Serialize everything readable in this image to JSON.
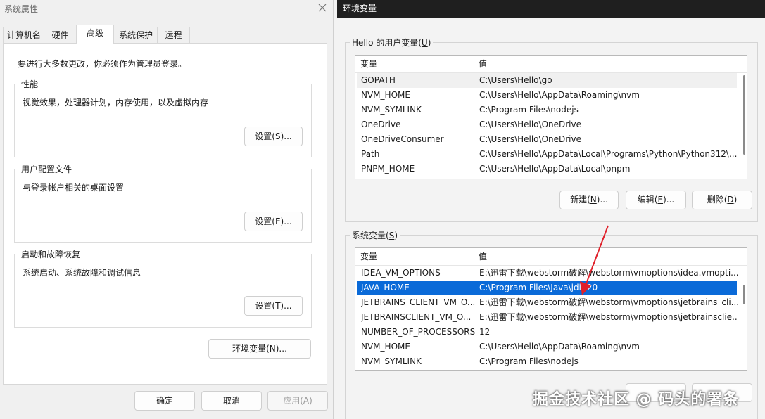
{
  "system_properties": {
    "title": "系统属性",
    "tabs": [
      "计算机名",
      "硬件",
      "高级",
      "系统保护",
      "远程"
    ],
    "admin_note": "要进行大多数更改，你必须作为管理员登录。",
    "performance": {
      "title": "性能",
      "desc": "视觉效果，处理器计划，内存使用，以及虚拟内存",
      "button": "设置(S)..."
    },
    "user_profile": {
      "title": "用户配置文件",
      "desc": "与登录帐户相关的桌面设置",
      "button": "设置(E)..."
    },
    "startup": {
      "title": "启动和故障恢复",
      "desc": "系统启动、系统故障和调试信息",
      "button": "设置(T)..."
    },
    "env_button": "环境变量(N)...",
    "ok": "确定",
    "cancel": "取消",
    "apply": "应用(A)"
  },
  "env_vars": {
    "title": "环境变量",
    "user_section": {
      "title_prefix": "Hello 的用户变量(",
      "title_key": "U",
      "title_suffix": ")"
    },
    "columns": {
      "name": "变量",
      "value": "值"
    },
    "user_rows": [
      {
        "name": "GOPATH",
        "value": "C:\\Users\\Hello\\go"
      },
      {
        "name": "NVM_HOME",
        "value": "C:\\Users\\Hello\\AppData\\Roaming\\nvm"
      },
      {
        "name": "NVM_SYMLINK",
        "value": "C:\\Program Files\\nodejs"
      },
      {
        "name": "OneDrive",
        "value": "C:\\Users\\Hello\\OneDrive"
      },
      {
        "name": "OneDriveConsumer",
        "value": "C:\\Users\\Hello\\OneDrive"
      },
      {
        "name": "Path",
        "value": "C:\\Users\\Hello\\AppData\\Local\\Programs\\Python\\Python312\\..."
      },
      {
        "name": "PNPM_HOME",
        "value": "C:\\Users\\Hello\\AppData\\Local\\pnpm"
      }
    ],
    "user_buttons": {
      "new": {
        "prefix": "新建(",
        "key": "N",
        "suffix": ")..."
      },
      "edit": {
        "prefix": "编辑(",
        "key": "E",
        "suffix": ")..."
      },
      "delete": {
        "prefix": "删除(",
        "key": "D",
        "suffix": ")"
      }
    },
    "system_section": {
      "title_prefix": "系统变量(",
      "title_key": "S",
      "title_suffix": ")"
    },
    "system_rows": [
      {
        "name": "IDEA_VM_OPTIONS",
        "value": "E:\\迅雷下载\\webstorm破解\\webstorm\\vmoptions\\idea.vmopti..."
      },
      {
        "name": "JAVA_HOME",
        "value": "C:\\Program Files\\Java\\jdk-20"
      },
      {
        "name": "JETBRAINS_CLIENT_VM_O...",
        "value": "E:\\迅雷下载\\webstorm破解\\webstorm\\vmoptions\\jetbrains_cli..."
      },
      {
        "name": "JETBRAINSCLIENT_VM_O...",
        "value": "E:\\迅雷下载\\webstorm破解\\webstorm\\vmoptions\\jetbrainsclie..."
      },
      {
        "name": "NUMBER_OF_PROCESSORS",
        "value": "12"
      },
      {
        "name": "NVM_HOME",
        "value": "C:\\Users\\Hello\\AppData\\Roaming\\nvm"
      },
      {
        "name": "NVM_SYMLINK",
        "value": "C:\\Program Files\\nodejs"
      }
    ],
    "selected_system_row": 1
  },
  "watermark": "掘金技术社区 @ 码头的署条",
  "colors": {
    "selection": "#0a6ad8",
    "arrow": "#e0202a",
    "titlebar": "#1f1f1f"
  },
  "icons": [
    "close-icon",
    "annotation-arrow-icon"
  ]
}
